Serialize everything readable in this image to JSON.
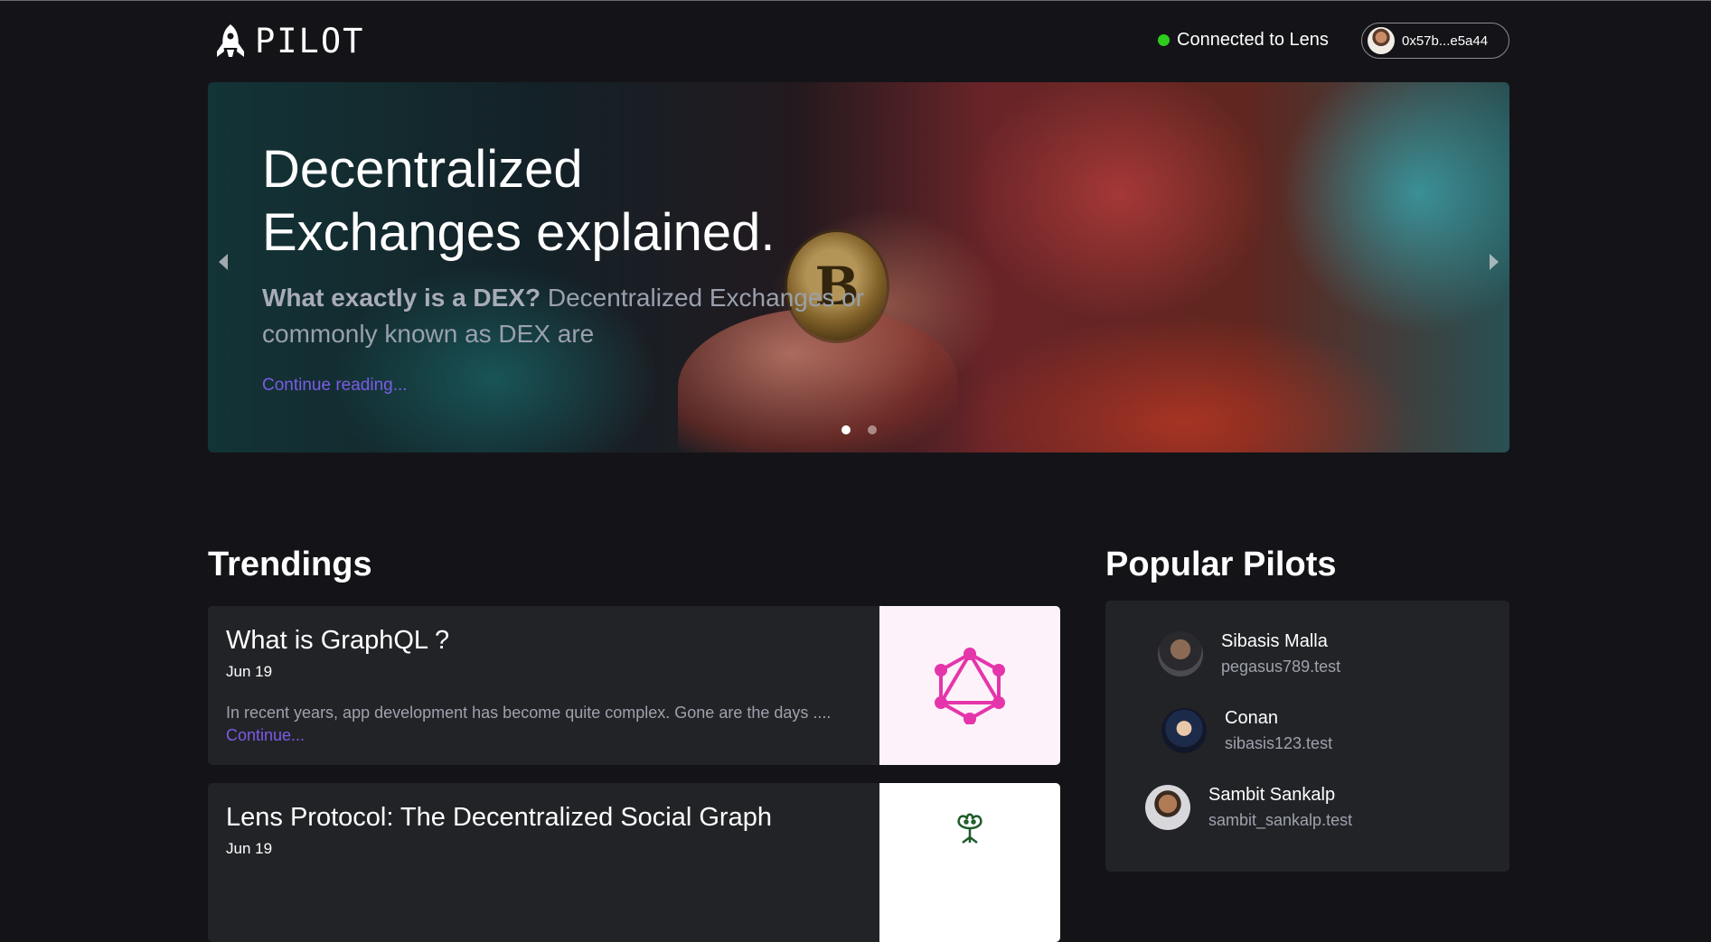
{
  "header": {
    "logo_text": "PILOT",
    "connection_status": "Connected to Lens",
    "wallet_address": "0x57b...e5a44"
  },
  "hero": {
    "title_line1": "Decentralized",
    "title_line2": "Exchanges explained.",
    "subtitle_bold": "What exactly is a DEX?",
    "subtitle_rest": " Decentralized Exchanges or commonly known as DEX are",
    "link_label": "Continue reading...",
    "slide_count": 2,
    "active_slide": 1
  },
  "trendings": {
    "title": "Trendings",
    "posts": [
      {
        "title": "What is GraphQL ?",
        "date": "Jun 19",
        "excerpt": "In recent years, app development has become quite complex. Gone are the days ....",
        "link_label": "Continue..."
      },
      {
        "title": "Lens Protocol: The Decentralized Social Graph",
        "date": "Jun 19"
      }
    ]
  },
  "popular": {
    "title": "Popular Pilots",
    "pilots": [
      {
        "name": "Sibasis Malla",
        "handle": "pegasus789.test"
      },
      {
        "name": "Conan",
        "handle": "sibasis123.test"
      },
      {
        "name": "Sambit Sankalp",
        "handle": "sambit_sankalp.test"
      }
    ]
  },
  "colors": {
    "background": "#141418",
    "card": "#222327",
    "accent": "#7b5ce6",
    "status_green": "#2ecc1f",
    "graphql_pink": "#e535ab"
  }
}
